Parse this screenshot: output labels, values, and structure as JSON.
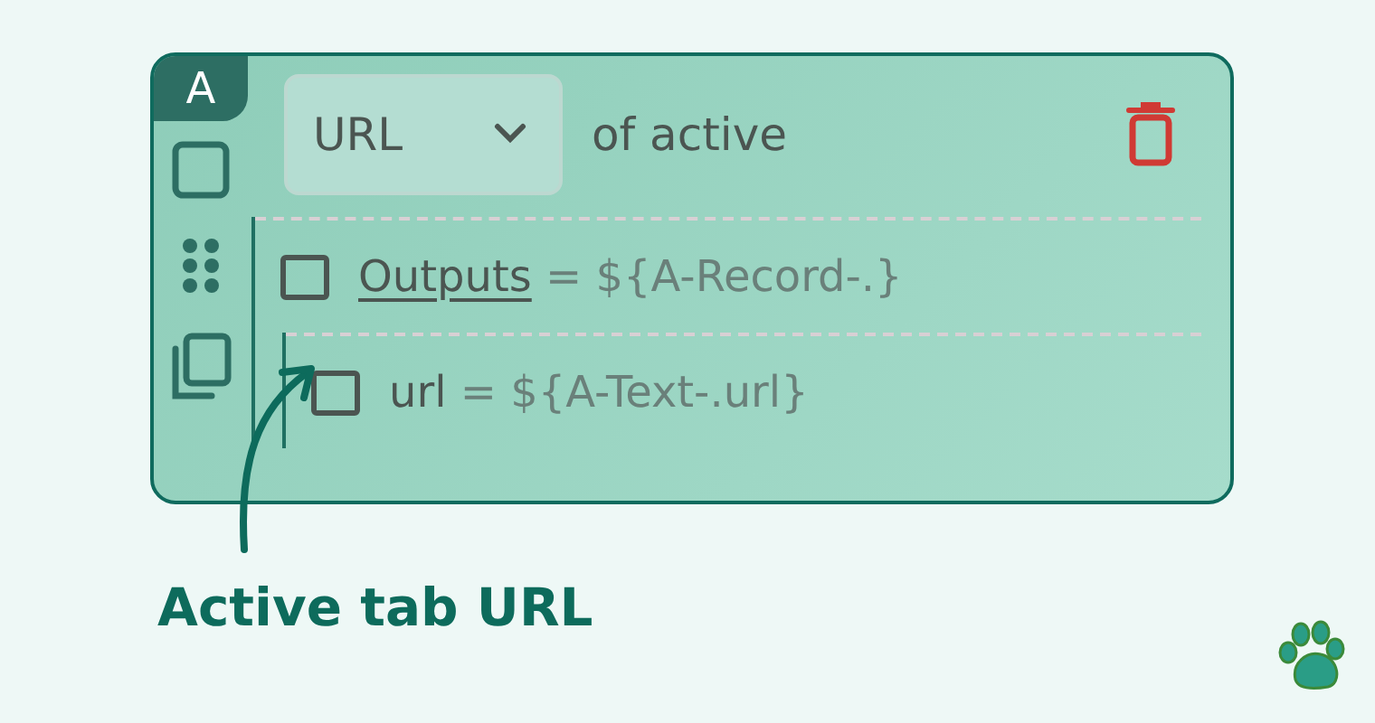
{
  "card": {
    "badge": "A",
    "selector": {
      "value": "URL"
    },
    "suffix": "of active",
    "rows": [
      {
        "kind": "link",
        "name": "Outputs",
        "expression": "= ${A-Record-.}",
        "checked": false,
        "children": [
          {
            "kind": "plain",
            "name": "url",
            "expression": "= ${A-Text-.url}",
            "checked": false
          }
        ]
      }
    ]
  },
  "caption": "Active tab URL"
}
